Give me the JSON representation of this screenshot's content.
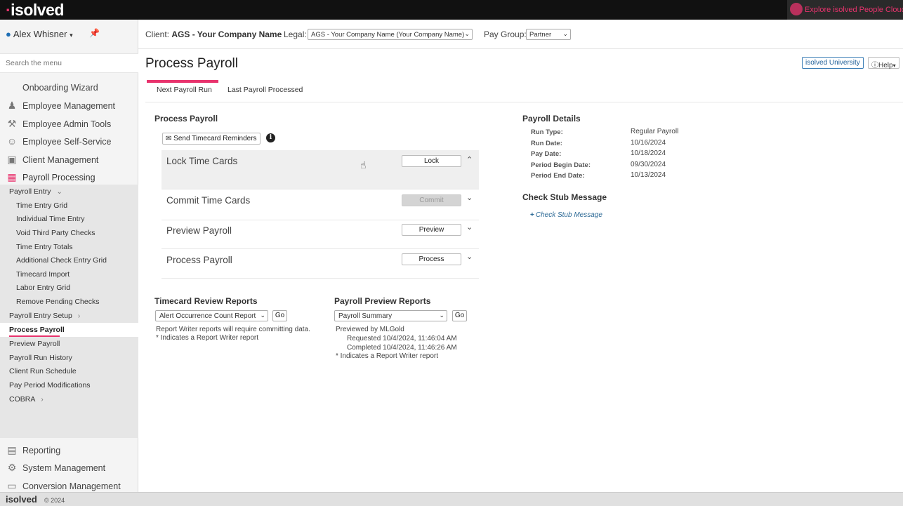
{
  "brand": {
    "logo_text": "isolved",
    "explore_label": "Explore isolved People Cloud",
    "accent": "#e8336d"
  },
  "user": {
    "name": "Alex Whisner"
  },
  "search": {
    "placeholder": "Search the menu"
  },
  "nav_top": [
    {
      "label": "Onboarding Wizard",
      "icon": "wizard-icon"
    },
    {
      "label": "Employee Management",
      "icon": "people-icon"
    },
    {
      "label": "Employee Admin Tools",
      "icon": "wrench-icon"
    },
    {
      "label": "Employee Self-Service",
      "icon": "person-icon"
    },
    {
      "label": "Client Management",
      "icon": "briefcase-icon"
    },
    {
      "label": "Payroll Processing",
      "icon": "calculator-icon"
    }
  ],
  "nav_sub": [
    {
      "label": "Payroll Entry",
      "level": 1,
      "chevron": "down"
    },
    {
      "label": "Time Entry Grid",
      "level": 2
    },
    {
      "label": "Individual Time Entry",
      "level": 2
    },
    {
      "label": "Void Third Party Checks",
      "level": 2
    },
    {
      "label": "Time Entry Totals",
      "level": 2
    },
    {
      "label": "Additional Check Entry Grid",
      "level": 2
    },
    {
      "label": "Timecard Import",
      "level": 2
    },
    {
      "label": "Labor Entry Grid",
      "level": 2
    },
    {
      "label": "Remove Pending Checks",
      "level": 2
    },
    {
      "label": "Payroll Entry Setup",
      "level": 1,
      "chevron": "right"
    },
    {
      "label": "Process Payroll",
      "level": 1,
      "active": true
    },
    {
      "label": "Preview Payroll",
      "level": 1
    },
    {
      "label": "Payroll Run History",
      "level": 1
    },
    {
      "label": "Client Run Schedule",
      "level": 1
    },
    {
      "label": "Pay Period Modifications",
      "level": 1
    },
    {
      "label": "COBRA",
      "level": 1,
      "chevron": "right"
    }
  ],
  "nav_bottom": [
    {
      "label": "Reporting",
      "icon": "chart-icon"
    },
    {
      "label": "System Management",
      "icon": "gear-icon"
    },
    {
      "label": "Conversion Management",
      "icon": "monitor-icon"
    }
  ],
  "footer": {
    "logo": "isolved",
    "copyright": "© 2024"
  },
  "header": {
    "client_label": "Client:",
    "client_value": "AGS - Your Company Name",
    "legal_label": "Legal:",
    "legal_value": "AGS - Your Company Name (Your Company Name)",
    "paygroup_label": "Pay Group:",
    "paygroup_value": "Partner"
  },
  "page": {
    "title": "Process Payroll",
    "university_label": "isolved University",
    "help_label": "Help"
  },
  "tabs": [
    {
      "label": "Next Payroll Run",
      "active": true
    },
    {
      "label": "Last Payroll Processed"
    }
  ],
  "process": {
    "title": "Process Payroll",
    "reminder_button": "Send Timecard Reminders",
    "steps": [
      {
        "name": "Lock Time Cards",
        "button": "Lock",
        "expanded": true,
        "disabled": false
      },
      {
        "name": "Commit Time Cards",
        "button": "Commit",
        "expanded": false,
        "disabled": true
      },
      {
        "name": "Preview Payroll",
        "button": "Preview",
        "expanded": false,
        "disabled": false
      },
      {
        "name": "Process Payroll",
        "button": "Process",
        "expanded": false,
        "disabled": false
      }
    ]
  },
  "timecard_reports": {
    "title": "Timecard Review Reports",
    "selected": "Alert Occurrence Count Report",
    "go_label": "Go",
    "note1": "Report Writer reports will require committing data.",
    "note2": "* Indicates a Report Writer report"
  },
  "preview_reports": {
    "title": "Payroll Preview Reports",
    "selected": "Payroll Summary",
    "go_label": "Go",
    "previewed_by": "Previewed by MLGold",
    "requested": "Requested 10/4/2024, 11:46:04 AM",
    "completed": "Completed 10/4/2024, 11:46:26 AM",
    "note": "* Indicates a Report Writer report"
  },
  "payroll_details": {
    "title": "Payroll Details",
    "rows": [
      {
        "label": "Run Type:",
        "value": "Regular Payroll"
      },
      {
        "label": "Run Date:",
        "value": "10/16/2024"
      },
      {
        "label": "Pay Date:",
        "value": "10/18/2024"
      },
      {
        "label": "Period Begin Date:",
        "value": "09/30/2024"
      },
      {
        "label": "Period End Date:",
        "value": "10/13/2024"
      }
    ]
  },
  "check_stub": {
    "title": "Check Stub Message",
    "add_label": "Check Stub Message"
  }
}
